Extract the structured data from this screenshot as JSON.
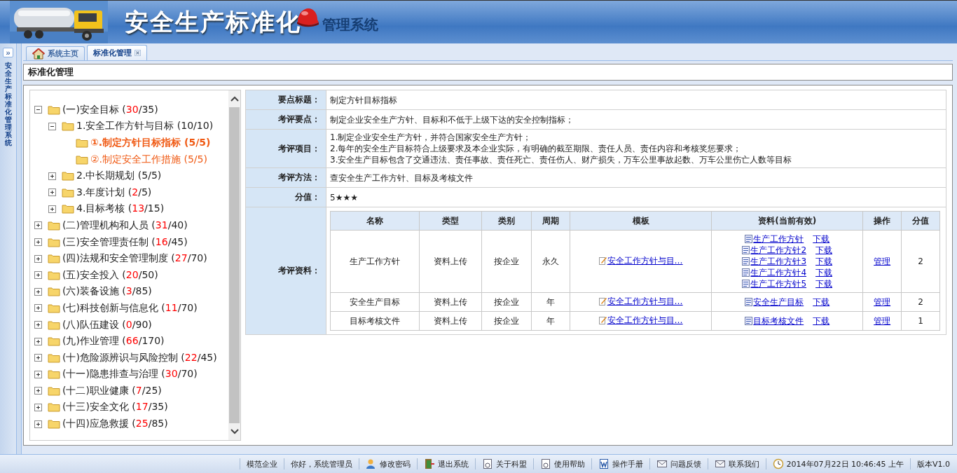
{
  "header": {
    "title": "安全生产标准化",
    "subtitle": "管理系统"
  },
  "sidebar": {
    "title": "安全生产标准化管理系统",
    "toggle": "»"
  },
  "tabs": [
    {
      "label": "系统主页",
      "kind": "home",
      "selected": false,
      "closable": false
    },
    {
      "label": "标准化管理",
      "kind": "plain",
      "selected": true,
      "closable": true
    }
  ],
  "page_title": "标准化管理",
  "tree": [
    {
      "label": "(一)安全目标 (",
      "done": "30",
      "total": "/35)",
      "complete": false,
      "expanded": true,
      "selected": false,
      "kind": "node",
      "children": [
        {
          "label": "1.安全工作方针与目标 (",
          "done": "10",
          "total": "/10)",
          "complete": true,
          "expanded": true,
          "selected": false,
          "kind": "node",
          "children": [
            {
              "label": "①.制定方针目标指标 (",
              "done": "5",
              "total": "/5)",
              "complete": true,
              "selected": true,
              "kind": "leaf"
            },
            {
              "label": "②.制定安全工作措施 (",
              "done": "5",
              "total": "/5)",
              "complete": true,
              "selected": false,
              "kind": "leaf"
            }
          ]
        },
        {
          "label": "2.中长期规划 (",
          "done": "5",
          "total": "/5)",
          "complete": true,
          "expanded": false,
          "selected": false,
          "kind": "node"
        },
        {
          "label": "3.年度计划 (",
          "done": "2",
          "total": "/5)",
          "complete": false,
          "expanded": false,
          "selected": false,
          "kind": "node"
        },
        {
          "label": "4.目标考核 (",
          "done": "13",
          "total": "/15)",
          "complete": false,
          "expanded": false,
          "selected": false,
          "kind": "node"
        }
      ]
    },
    {
      "label": "(二)管理机构和人员 (",
      "done": "31",
      "total": "/40)",
      "complete": false,
      "expanded": false,
      "selected": false,
      "kind": "node"
    },
    {
      "label": "(三)安全管理责任制 (",
      "done": "16",
      "total": "/45)",
      "complete": false,
      "expanded": false,
      "selected": false,
      "kind": "node"
    },
    {
      "label": "(四)法规和安全管理制度 (",
      "done": "27",
      "total": "/70)",
      "complete": false,
      "expanded": false,
      "selected": false,
      "kind": "node"
    },
    {
      "label": "(五)安全投入 (",
      "done": "20",
      "total": "/50)",
      "complete": false,
      "expanded": false,
      "selected": false,
      "kind": "node"
    },
    {
      "label": "(六)装备设施 (",
      "done": "3",
      "total": "/85)",
      "complete": false,
      "expanded": false,
      "selected": false,
      "kind": "node"
    },
    {
      "label": "(七)科技创新与信息化 (",
      "done": "11",
      "total": "/70)",
      "complete": false,
      "expanded": false,
      "selected": false,
      "kind": "node"
    },
    {
      "label": "(八)队伍建设 (",
      "done": "0",
      "total": "/90)",
      "complete": false,
      "expanded": false,
      "selected": false,
      "kind": "node"
    },
    {
      "label": "(九)作业管理 (",
      "done": "66",
      "total": "/170)",
      "complete": false,
      "expanded": false,
      "selected": false,
      "kind": "node"
    },
    {
      "label": "(十)危险源辨识与风险控制 (",
      "done": "22",
      "total": "/45)",
      "complete": false,
      "expanded": false,
      "selected": false,
      "kind": "node"
    },
    {
      "label": "(十一)隐患排查与治理 (",
      "done": "30",
      "total": "/70)",
      "complete": false,
      "expanded": false,
      "selected": false,
      "kind": "node"
    },
    {
      "label": "(十二)职业健康 (",
      "done": "7",
      "total": "/25)",
      "complete": false,
      "expanded": false,
      "selected": false,
      "kind": "node"
    },
    {
      "label": "(十三)安全文化 (",
      "done": "17",
      "total": "/35)",
      "complete": false,
      "expanded": false,
      "selected": false,
      "kind": "node"
    },
    {
      "label": "(十四)应急救援 (",
      "done": "25",
      "total": "/85)",
      "complete": false,
      "expanded": false,
      "selected": false,
      "kind": "node"
    }
  ],
  "detail": {
    "key_title": {
      "label": "要点标题：",
      "value": "制定方针目标指标"
    },
    "key_points": {
      "label": "考评要点：",
      "value": "制定企业安全生产方针、目标和不低于上级下达的安全控制指标；"
    },
    "items": {
      "label": "考评项目：",
      "lines": [
        "1.制定企业安全生产方针，并符合国家安全生产方针；",
        "2.每年的安全生产目标符合上级要求及本企业实际，有明确的截至期限、责任人员、责任内容和考核奖惩要求；",
        "3.安全生产目标包含了交通违法、责任事故、责任死亡、责任伤人、财产损失，万车公里事故起数、万车公里伤亡人数等目标"
      ]
    },
    "method": {
      "label": "考评方法：",
      "value": "查安全生产工作方针、目标及考核文件"
    },
    "score": {
      "label": "分值：",
      "value": "5",
      "stars": 3
    },
    "materials": {
      "label": "考评资料：",
      "columns": [
        "名称",
        "类型",
        "类别",
        "周期",
        "模板",
        "资料(当前有效)",
        "操作",
        "分值"
      ],
      "rows": [
        {
          "name": "生产工作方针",
          "type": "资料上传",
          "category": "按企业",
          "period": "永久",
          "template": "安全工作方针与目…",
          "files": [
            {
              "name": "生产工作方针",
              "download": "下载"
            },
            {
              "name": "生产工作方针2",
              "download": "下载"
            },
            {
              "name": "生产工作方针3",
              "download": "下载"
            },
            {
              "name": "生产工作方针4",
              "download": "下载"
            },
            {
              "name": "生产工作方针5",
              "download": "下载"
            }
          ],
          "action": "管理",
          "score": "2"
        },
        {
          "name": "安全生产目标",
          "type": "资料上传",
          "category": "按企业",
          "period": "年",
          "template": "安全工作方针与目…",
          "files": [
            {
              "name": "安全生产目标",
              "download": "下载"
            }
          ],
          "action": "管理",
          "score": "2"
        },
        {
          "name": "目标考核文件",
          "type": "资料上传",
          "category": "按企业",
          "period": "年",
          "template": "安全工作方针与目…",
          "files": [
            {
              "name": "目标考核文件",
              "download": "下载"
            }
          ],
          "action": "管理",
          "score": "1"
        }
      ]
    }
  },
  "status_bar": [
    {
      "kind": "text",
      "label": "模范企业"
    },
    {
      "kind": "text",
      "label": "你好，系统管理员"
    },
    {
      "kind": "user",
      "label": "修改密码"
    },
    {
      "kind": "exit",
      "label": "退出系统"
    },
    {
      "kind": "doc",
      "label": "关于科盟"
    },
    {
      "kind": "doc",
      "label": "使用帮助"
    },
    {
      "kind": "word",
      "label": "操作手册"
    },
    {
      "kind": "mail",
      "label": "问题反馈"
    },
    {
      "kind": "mail",
      "label": "联系我们"
    },
    {
      "kind": "clock",
      "label": "2014年07月22日 10:46:45 上午"
    },
    {
      "kind": "text",
      "label": "版本V1.0"
    }
  ]
}
